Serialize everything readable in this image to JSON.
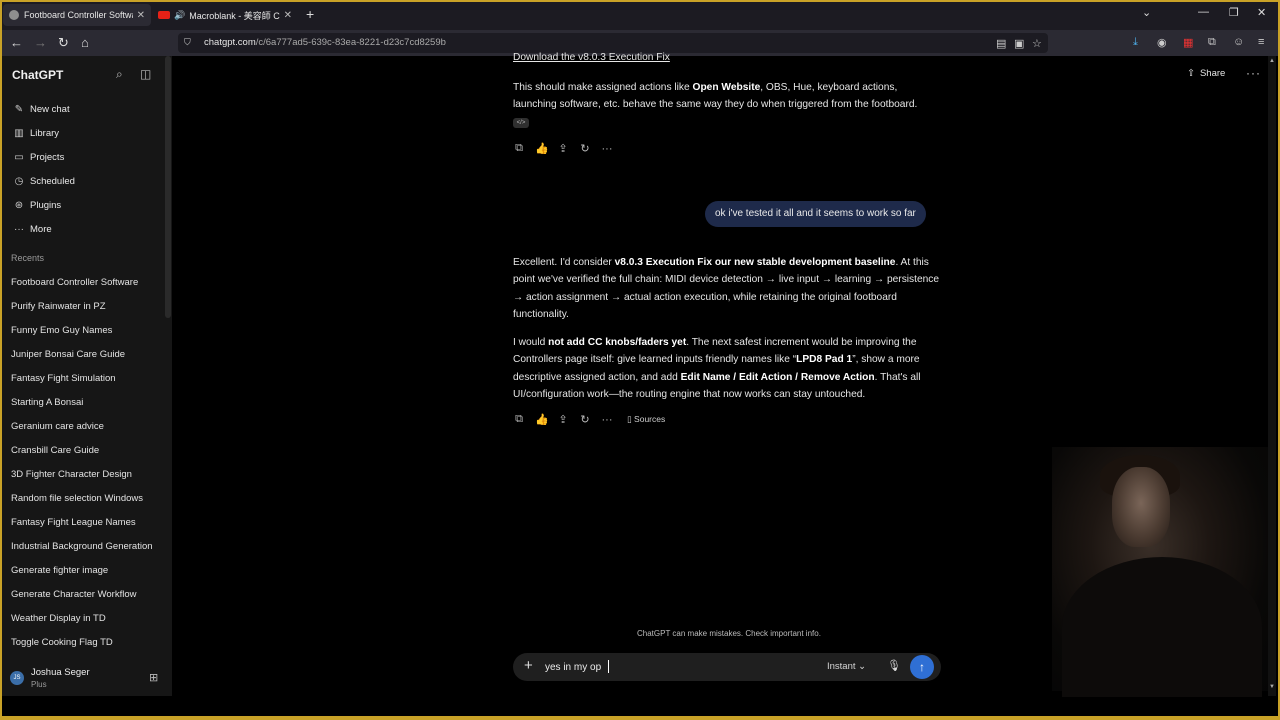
{
  "browser": {
    "tabs": [
      {
        "title": "Footboard Controller Software",
        "active": true
      },
      {
        "title": "Macroblank - 美容師 COLL",
        "active": false
      }
    ],
    "url_host": "chatgpt.com",
    "url_path": "/c/6a777ad5-639c-83ea-8221-d23c7cd8259b",
    "extension_badge": "315"
  },
  "sidebar": {
    "brand": "ChatGPT",
    "menu": [
      {
        "label": "New chat",
        "icon": "compose-icon"
      },
      {
        "label": "Library",
        "icon": "library-icon"
      },
      {
        "label": "Projects",
        "icon": "folder-icon"
      },
      {
        "label": "Scheduled",
        "icon": "clock-icon"
      },
      {
        "label": "Plugins",
        "icon": "plugins-icon"
      },
      {
        "label": "More",
        "icon": "more-icon"
      }
    ],
    "recents_heading": "Recents",
    "recents": [
      "Footboard Controller Software",
      "Purify Rainwater in PZ",
      "Funny Emo Guy Names",
      "Juniper Bonsai Care Guide",
      "Fantasy Fight Simulation",
      "Starting A Bonsai",
      "Geranium care advice",
      "Cransbill Care Guide",
      "3D Fighter Character Design",
      "Random file selection Windows",
      "Fantasy Fight League Names",
      "Industrial Background Generation",
      "Generate fighter image",
      "Generate Character Workflow",
      "Weather Display in TD",
      "Toggle Cooking Flag TD"
    ],
    "user": {
      "initials": "JS",
      "name": "Joshua Seger",
      "plan": "Plus"
    }
  },
  "header": {
    "share_label": "Share"
  },
  "chat": {
    "download_link": "Download the v8.0.3 Execution Fix",
    "msg1_a": "This should make assigned actions like ",
    "msg1_b": "Open Website",
    "msg1_c": ", OBS, Hue, keyboard actions, launching software, etc. behave the same way they do when triggered from the footboard.",
    "code_badge": "</>",
    "user_message": "ok i've tested it all and it seems to work so far",
    "p1_a": "Excellent. I'd consider ",
    "p1_b": "v8.0.3 Execution Fix our new stable development baseline",
    "p1_c": ". At this point we've verified the full chain: MIDI device detection → live input → learning → persistence → action assignment → actual action execution, while retaining the original footboard functionality.",
    "p2_a": "I would ",
    "p2_b": "not add CC knobs/faders yet",
    "p2_c": ". The next safest increment would be improving the Controllers page itself: give learned inputs friendly names like “",
    "p2_d": "LPD8 Pad 1",
    "p2_e": "”, show a more descriptive assigned action, and add ",
    "p2_f": "Edit Name / Edit Action / Remove Action",
    "p2_g": ". That's all UI/configuration work—the routing engine that now works can stay untouched.",
    "sources_label": "Sources"
  },
  "composer": {
    "disclaimer": "ChatGPT can make mistakes. Check important info.",
    "value": "yes in my op",
    "model_label": "Instant"
  }
}
